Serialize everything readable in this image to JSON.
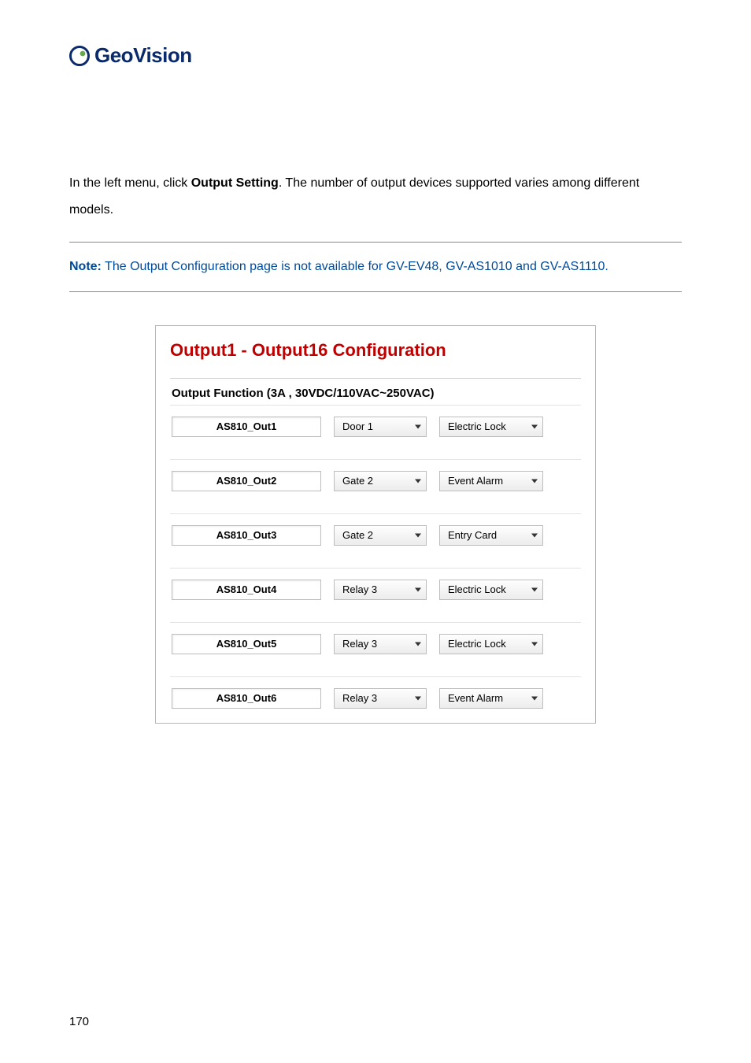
{
  "brand": {
    "name": "GeoVision"
  },
  "intro": {
    "pre": "In the left menu, click ",
    "bold": "Output Setting",
    "post": ". The number of output devices supported varies among different models."
  },
  "note": {
    "lead": "Note:",
    "body": " The Output Configuration page is not available for GV-EV48, GV-AS1010 and GV-AS1110."
  },
  "config": {
    "title": "Output1 - Output16 Configuration",
    "subtitle": "Output Function (3A , 30VDC/110VAC~250VAC)",
    "rows": [
      {
        "name": "AS810_Out1",
        "sel1": "Door 1",
        "sel2": "Electric Lock"
      },
      {
        "name": "AS810_Out2",
        "sel1": "Gate 2",
        "sel2": "Event Alarm"
      },
      {
        "name": "AS810_Out3",
        "sel1": "Gate 2",
        "sel2": "Entry Card"
      },
      {
        "name": "AS810_Out4",
        "sel1": "Relay 3",
        "sel2": "Electric Lock"
      },
      {
        "name": "AS810_Out5",
        "sel1": "Relay 3",
        "sel2": "Electric Lock"
      },
      {
        "name": "AS810_Out6",
        "sel1": "Relay 3",
        "sel2": "Event Alarm"
      }
    ]
  },
  "page_number": "170"
}
